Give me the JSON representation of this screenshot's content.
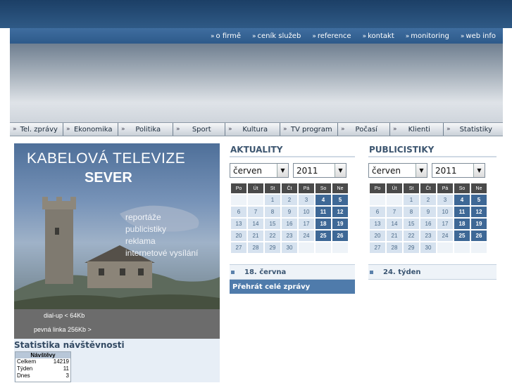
{
  "topnav": {
    "items": [
      {
        "label": "o firmě"
      },
      {
        "label": "ceník služeb"
      },
      {
        "label": "reference"
      },
      {
        "label": "kontakt"
      },
      {
        "label": "monitoring"
      },
      {
        "label": "web info"
      }
    ]
  },
  "tabs": [
    {
      "label": "Tel. zprávy"
    },
    {
      "label": "Ekonomika"
    },
    {
      "label": "Politika"
    },
    {
      "label": "Sport"
    },
    {
      "label": "Kultura"
    },
    {
      "label": "TV program"
    },
    {
      "label": "Počasí"
    },
    {
      "label": "Klienti"
    },
    {
      "label": "Statistiky"
    }
  ],
  "promo": {
    "title_line1": "KABELOVÁ TELEVIZE",
    "title_line2": "SEVER",
    "taglines": [
      "reportáže",
      "publicistiky",
      "reklama",
      "internetové vysílání"
    ],
    "stream_low": "dial-up < 64Kb",
    "stream_high": "pevná linka 256Kb >"
  },
  "stats": {
    "heading": "Statistika návštěvnosti",
    "counter_title": "Návštěvy",
    "rows": [
      {
        "label": "Celkem",
        "value": "14219"
      },
      {
        "label": "Týden",
        "value": "11"
      },
      {
        "label": "Dnes",
        "value": "3"
      }
    ]
  },
  "weekdays": [
    "Po",
    "Út",
    "St",
    "Čt",
    "Pá",
    "So",
    "Ne"
  ],
  "aktuality": {
    "heading": "AKTUALITY",
    "month": "červen",
    "year": "2011",
    "date_label": "18. června",
    "play_label": "Přehrát celé zprávy"
  },
  "publicistiky": {
    "heading": "PUBLICISTIKY",
    "month": "červen",
    "year": "2011",
    "date_label": "24. týden"
  },
  "calendar": {
    "weeks": [
      [
        "",
        "",
        "1",
        "2",
        "3",
        "4",
        "5"
      ],
      [
        "6",
        "7",
        "8",
        "9",
        "10",
        "11",
        "12"
      ],
      [
        "13",
        "14",
        "15",
        "16",
        "17",
        "18",
        "19"
      ],
      [
        "20",
        "21",
        "22",
        "23",
        "24",
        "25",
        "26"
      ],
      [
        "27",
        "28",
        "29",
        "30",
        "",
        "",
        ""
      ]
    ],
    "highlighted": [
      "4",
      "5",
      "11",
      "12",
      "18",
      "19",
      "25",
      "26"
    ]
  }
}
